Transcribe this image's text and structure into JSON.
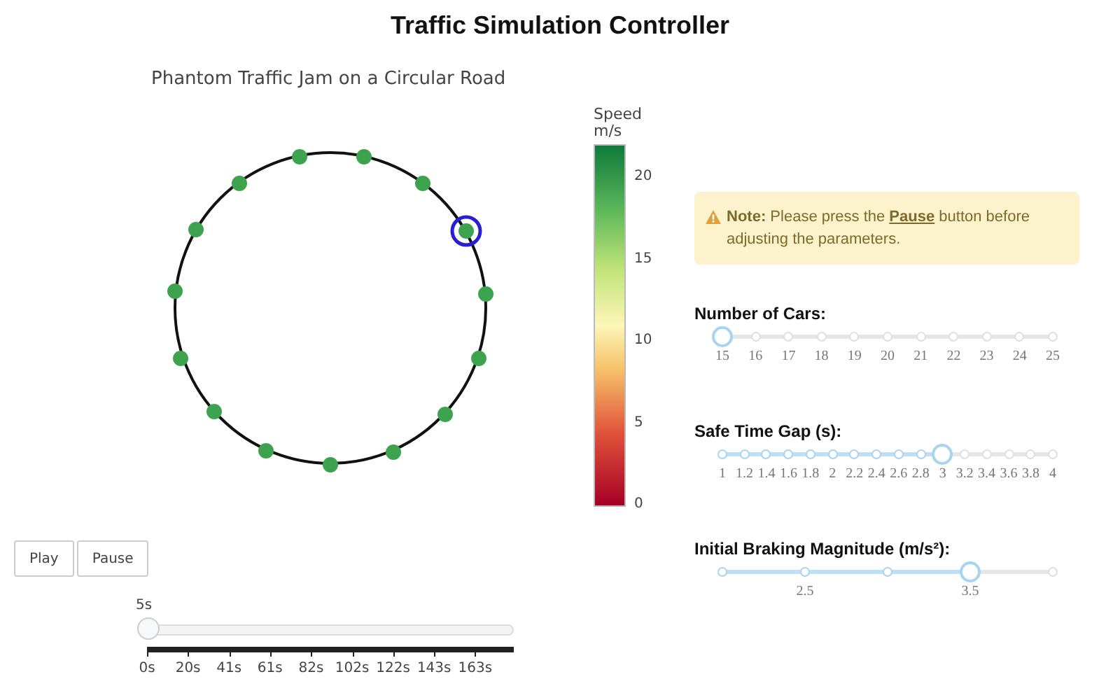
{
  "title": "Traffic Simulation Controller",
  "plot": {
    "title": "Phantom Traffic Jam on a Circular Road",
    "colorbar": {
      "title": "Speed",
      "unit": "m/s",
      "ticks": [
        "20",
        "15",
        "10",
        "5",
        "0"
      ]
    }
  },
  "controls": {
    "buttons": [
      {
        "label": "Play"
      },
      {
        "label": "Pause"
      }
    ],
    "time_slider": {
      "current": "5s",
      "level": 0,
      "ticks": [
        "0s",
        "20s",
        "41s",
        "61s",
        "82s",
        "102s",
        "122s",
        "143s",
        "163s"
      ]
    }
  },
  "note": {
    "label": "Note:",
    "text": "Please press the **Pause** button before adjusting the parameters."
  },
  "sliders": [
    {
      "label": "Number of Cars:",
      "level": 0,
      "steps": [
        {
          "label": "15"
        },
        {
          "label": "16"
        },
        {
          "label": "17"
        },
        {
          "label": "18"
        },
        {
          "label": "19"
        },
        {
          "label": "20"
        },
        {
          "label": "21"
        },
        {
          "label": "22"
        },
        {
          "label": "23"
        },
        {
          "label": "24"
        },
        {
          "label": "25"
        }
      ]
    },
    {
      "label": "Safe Time Gap (s):",
      "level": 0.6667,
      "steps": [
        {
          "label": "1"
        },
        {
          "label": "1.2"
        },
        {
          "label": "1.4"
        },
        {
          "label": "1.6"
        },
        {
          "label": "1.8"
        },
        {
          "label": "2"
        },
        {
          "label": "2.2"
        },
        {
          "label": "2.4"
        },
        {
          "label": "2.6"
        },
        {
          "label": "2.8"
        },
        {
          "label": "3"
        },
        {
          "label": "3.2"
        },
        {
          "label": "3.4"
        },
        {
          "label": "3.6"
        },
        {
          "label": "3.8"
        },
        {
          "label": "4"
        }
      ]
    },
    {
      "label": "Initial Braking Magnitude (m/s²):",
      "level": 0.75,
      "steps": [
        {
          "kind": "plain"
        },
        {
          "kind": "labeled",
          "label": "2.5"
        },
        {
          "kind": "plain"
        },
        {
          "kind": "labeled",
          "label": "3.5"
        },
        {
          "kind": "plain"
        }
      ]
    }
  ]
}
